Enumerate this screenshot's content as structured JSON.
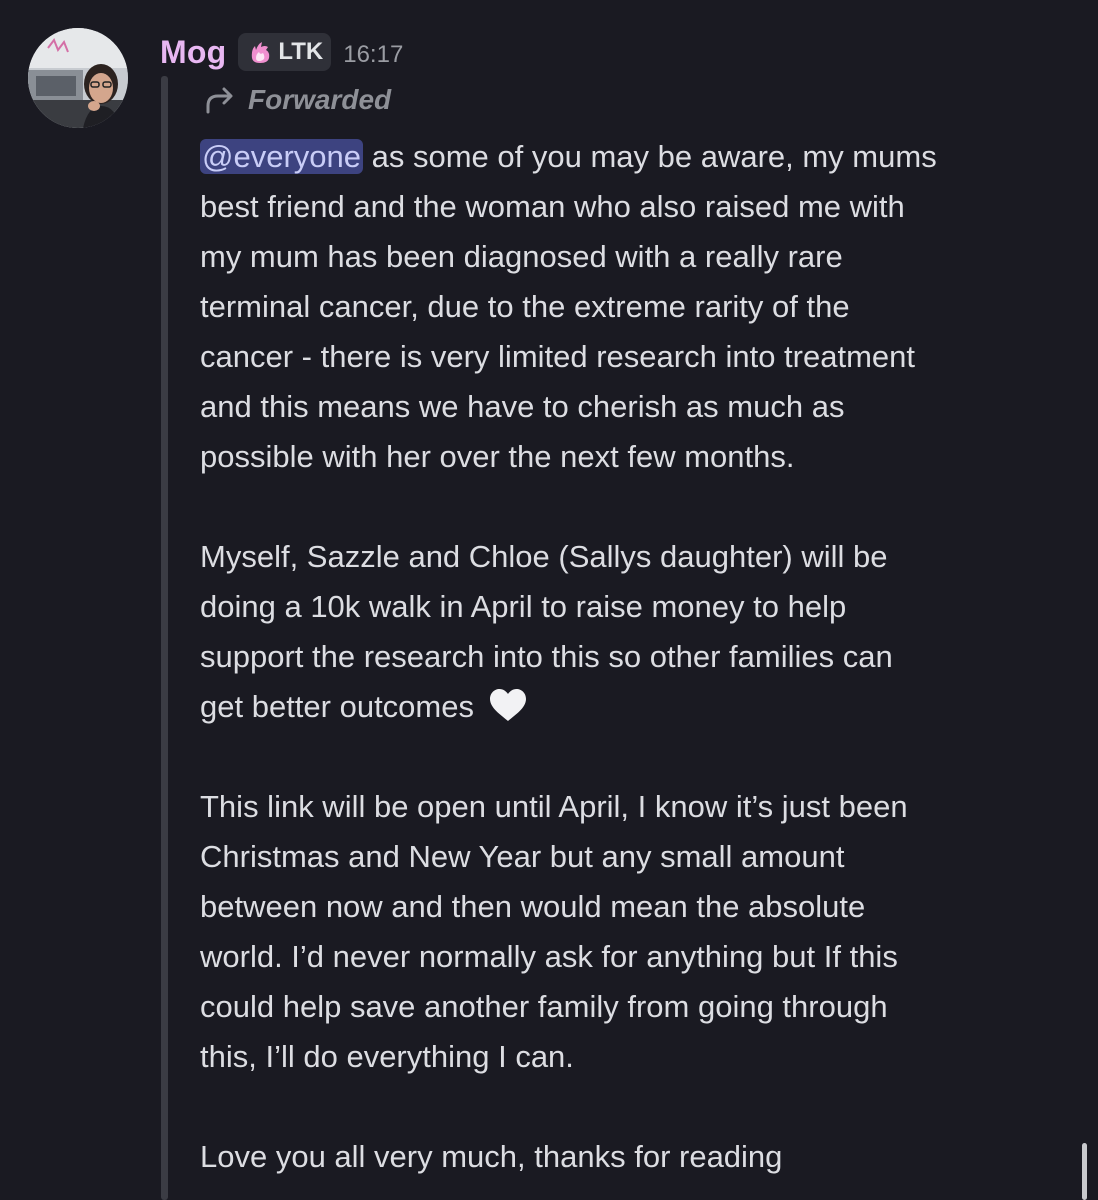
{
  "message": {
    "username": "Mog",
    "tag_label": "LTK",
    "timestamp": "16:17",
    "forwarded_label": "Forwarded",
    "mention": "@everyone",
    "line_1_rest": " as some of you may be aware, my mums",
    "line_2": "best friend and the woman who also raised me with",
    "line_3": "my mum has been diagnosed with a really rare",
    "line_4": "terminal cancer, due to the extreme rarity of the",
    "line_5": "cancer - there is very limited research into treatment",
    "line_6": "and this means we have to cherish as much as",
    "line_7": "possible with her over the next few months.",
    "para2_line_1": "Myself, Sazzle and Chloe (Sallys daughter) will be",
    "para2_line_2": "doing a 10k walk in April to raise money to help",
    "para2_line_3": "support the research into this so other families can",
    "para2_line_4": "get better outcomes",
    "para3_line_1": "This link will be open until April, I know it’s just been",
    "para3_line_2": "Christmas and New Year but any small amount",
    "para3_line_3": "between now and then would mean the absolute",
    "para3_line_4": "world. I’d never normally ask for anything but If this",
    "para3_line_5": "could help save another family from going through",
    "para3_line_6": "this, I’ll do everything I can.",
    "para4_line_1": "Love you all very much, thanks for reading"
  },
  "icons": {
    "avatar": "user-avatar-photo",
    "tag": "pink-flame-icon",
    "forward": "forward-arrow-icon",
    "heart": "white-heart-emoji"
  },
  "colors": {
    "background": "#1a1a22",
    "username": "#e8b7f2",
    "mention_bg": "#3d4380",
    "mention_text": "#c9cdf7",
    "text": "#dcdde2",
    "muted": "#8e9097"
  }
}
